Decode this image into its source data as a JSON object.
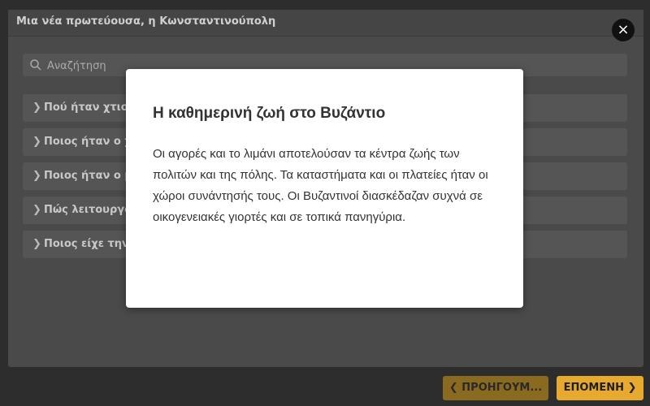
{
  "window": {
    "title": "Μια νέα πρωτεύουσα, η Κωνσταντινούπολη",
    "close_glyph": "×"
  },
  "search": {
    "placeholder": "Αναζήτηση",
    "icon": "search-icon"
  },
  "accordion": [
    {
      "label": "Πού ήταν χτισμ"
    },
    {
      "label": "Ποιος ήταν ο χ"
    },
    {
      "label": "Ποιος ήταν ο μ"
    },
    {
      "label": "Πώς λειτουργο"
    },
    {
      "label": "Ποιος είχε την"
    }
  ],
  "modal": {
    "title": "Η καθημερινή ζωή στο Βυζάντιο",
    "body": "Οι αγορές και το λιμάνι αποτελούσαν τα κέντρα ζωής των πολιτών και της πόλης. Τα καταστήματα και οι πλατείες ήταν οι χώροι συνάντησής τους. Οι Βυζαντινοί διασκέδαζαν συχνά σε οικογενειακές γιορτές και σε τοπικά πανηγύρια."
  },
  "footer": {
    "prev_label": "ΠΡΟΗΓΟΥΜ...",
    "next_label": "ΕΠΟΜΕΝΗ"
  },
  "colors": {
    "accent": "#e7a92e",
    "accent_dim": "#8a6a1e",
    "backdrop": "#2d2d2d"
  }
}
